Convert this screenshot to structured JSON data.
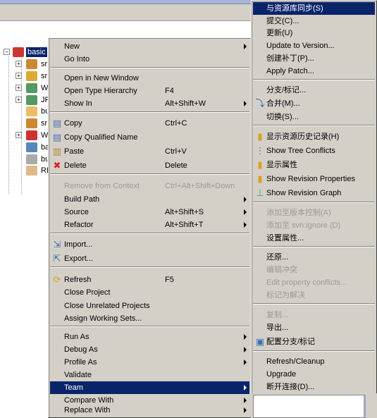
{
  "tree": {
    "nodes": [
      {
        "label": "basic",
        "icon": "project-icon",
        "selected": true
      },
      {
        "label": "sr",
        "icon": "source-folder-icon"
      },
      {
        "label": "sr",
        "icon": "source-folder-warning-icon"
      },
      {
        "label": "W",
        "icon": "library-icon"
      },
      {
        "label": "JR",
        "icon": "jre-library-icon"
      },
      {
        "label": "bu",
        "icon": "folder-icon"
      },
      {
        "label": "sr",
        "icon": "svn-folder-icon"
      },
      {
        "label": "W",
        "icon": "webcontent-folder-icon"
      },
      {
        "label": "ba",
        "icon": "file-icon"
      },
      {
        "label": "bu",
        "icon": "build-file-warning-icon"
      },
      {
        "label": "RE",
        "icon": "text-file-icon"
      }
    ]
  },
  "context_menu": {
    "items": [
      {
        "label": "New",
        "submenu": true
      },
      {
        "label": "Go Into"
      },
      {
        "sep": true
      },
      {
        "label": "Open in New Window"
      },
      {
        "label": "Open Type Hierarchy",
        "shortcut": "F4"
      },
      {
        "label": "Show In",
        "shortcut": "Alt+Shift+W",
        "submenu": true
      },
      {
        "sep": true
      },
      {
        "label": "Copy",
        "shortcut": "Ctrl+C",
        "icon": "copy-icon"
      },
      {
        "label": "Copy Qualified Name",
        "icon": "copy-qualified-name-icon"
      },
      {
        "label": "Paste",
        "shortcut": "Ctrl+V",
        "icon": "paste-icon"
      },
      {
        "label": "Delete",
        "shortcut": "Delete",
        "icon": "delete-icon"
      },
      {
        "sep": true
      },
      {
        "label": "Remove from Context",
        "shortcut": "Ctrl+Alt+Shift+Down",
        "disabled": true
      },
      {
        "label": "Build Path",
        "submenu": true
      },
      {
        "label": "Source",
        "shortcut": "Alt+Shift+S",
        "submenu": true
      },
      {
        "label": "Refactor",
        "shortcut": "Alt+Shift+T",
        "submenu": true
      },
      {
        "sep": true
      },
      {
        "label": "Import...",
        "icon": "import-icon"
      },
      {
        "label": "Export...",
        "icon": "export-icon"
      },
      {
        "sep": true
      },
      {
        "label": "Refresh",
        "shortcut": "F5",
        "icon": "refresh-icon"
      },
      {
        "label": "Close Project"
      },
      {
        "label": "Close Unrelated Projects"
      },
      {
        "label": "Assign Working Sets..."
      },
      {
        "sep": true
      },
      {
        "label": "Run As",
        "submenu": true
      },
      {
        "label": "Debug As",
        "submenu": true
      },
      {
        "label": "Profile As",
        "submenu": true
      },
      {
        "label": "Validate"
      },
      {
        "label": "Team",
        "submenu": true,
        "highlighted": true
      },
      {
        "label": "Compare With",
        "submenu": true
      },
      {
        "label": "Replace With",
        "submenu": true
      }
    ]
  },
  "team_submenu": {
    "items": [
      {
        "label": "与资源库同步(S)",
        "highlighted": true
      },
      {
        "label": "提交(C)..."
      },
      {
        "label": "更新(U)"
      },
      {
        "label": "Update to Version..."
      },
      {
        "label": "创建补丁(P)..."
      },
      {
        "label": "Apply Patch..."
      },
      {
        "sep": true
      },
      {
        "label": "分支/标记..."
      },
      {
        "label": "合并(M)...",
        "icon": "merge-icon"
      },
      {
        "label": "切换(S)..."
      },
      {
        "sep": true
      },
      {
        "label": "显示资源历史记录(H)",
        "icon": "history-icon"
      },
      {
        "label": "Show Tree Conflicts",
        "icon": "tree-conflicts-icon"
      },
      {
        "label": "显示属性",
        "icon": "properties-icon"
      },
      {
        "label": "Show Revision Properties",
        "icon": "revision-properties-icon"
      },
      {
        "label": "Show Revision Graph",
        "icon": "revision-graph-icon"
      },
      {
        "sep": true
      },
      {
        "label": "添加至版本控制(A)",
        "disabled": true
      },
      {
        "label": "添加至 svn:ignore (D)",
        "disabled": true
      },
      {
        "label": "设置属性..."
      },
      {
        "sep": true
      },
      {
        "label": "还原..."
      },
      {
        "label": "编辑冲突",
        "disabled": true
      },
      {
        "label": "Edit property conflicts...",
        "disabled": true
      },
      {
        "label": "标记为解决",
        "disabled": true
      },
      {
        "sep": true
      },
      {
        "label": "复制...",
        "disabled": true
      },
      {
        "label": "导出..."
      },
      {
        "label": "配置分支/标记",
        "icon": "configure-branches-icon"
      },
      {
        "sep": true
      },
      {
        "label": "Refresh/Cleanup"
      },
      {
        "label": "Upgrade"
      },
      {
        "label": "断开连接(D)..."
      }
    ]
  },
  "colors": {
    "highlight": "#0a246a",
    "menu_bg": "#d4d0c8",
    "disabled": "#9c9a94"
  }
}
